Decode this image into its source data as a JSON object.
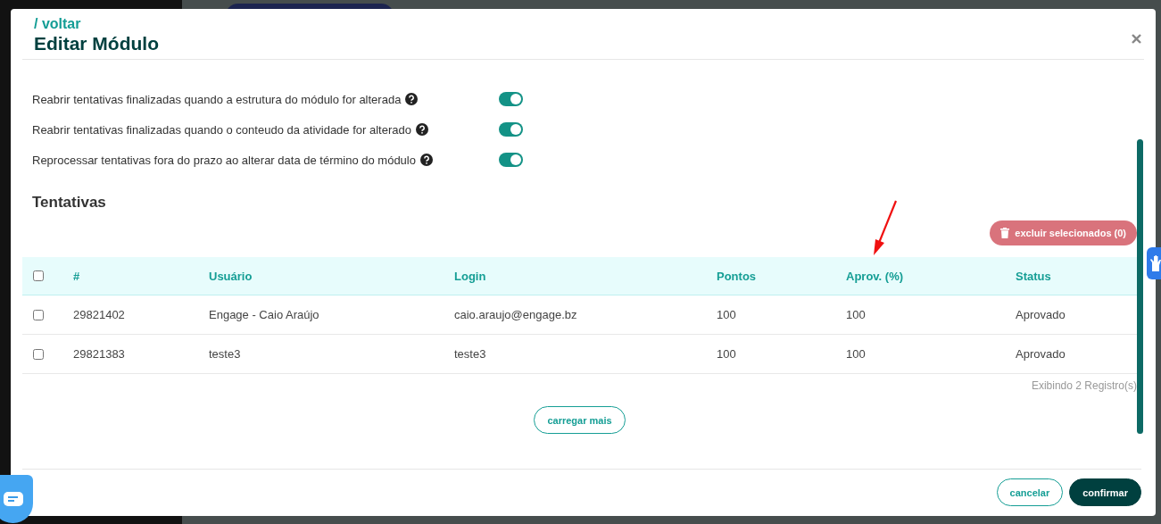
{
  "modal": {
    "back_link": "/ voltar",
    "title": "Editar Módulo"
  },
  "settings": [
    {
      "label": "Reabrir tentativas finalizadas quando a estrutura do módulo for alterada",
      "on": true
    },
    {
      "label": "Reabrir tentativas finalizadas quando o conteudo da atividade for alterado",
      "on": true
    },
    {
      "label": "Reprocessar tentativas fora do prazo ao alterar data de término do módulo",
      "on": true
    }
  ],
  "section_title": "Tentativas",
  "delete_button": {
    "label": "excluir selecionados (0)",
    "disabled": true
  },
  "table": {
    "select_all": {
      "checked": false
    },
    "columns": [
      "#",
      "Usuário",
      "Login",
      "Pontos",
      "Aprov. (%)",
      "Status"
    ],
    "rows": [
      {
        "checked": false,
        "cells": [
          "29821402",
          "Engage - Caio Araújo",
          "caio.araujo@engage.bz",
          "100",
          "100",
          "Aprovado"
        ]
      },
      {
        "checked": false,
        "cells": [
          "29821383",
          "teste3",
          "teste3",
          "100",
          "100",
          "Aprovado"
        ]
      }
    ]
  },
  "record_count": "Exibindo 2 Registro(s)",
  "load_more": "carregar mais",
  "footer_buttons": [
    {
      "label": "cancelar",
      "kind": "secondary"
    },
    {
      "label": "confirmar",
      "kind": "primary"
    }
  ]
}
